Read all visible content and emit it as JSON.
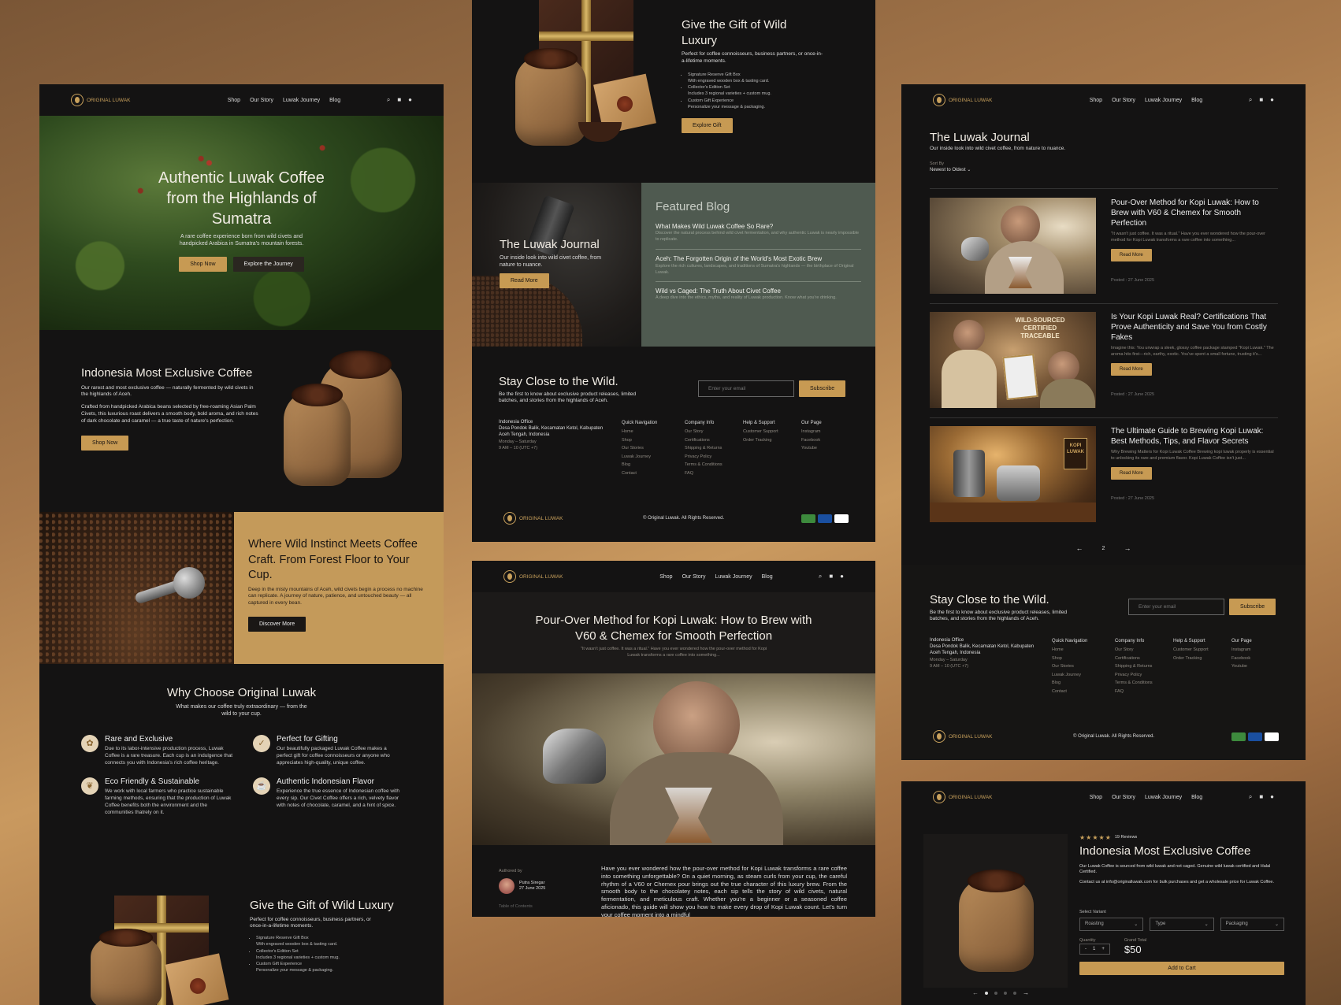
{
  "nav": {
    "logo": "ORIGINAL LUWAK",
    "links": [
      "Shop",
      "Our Story",
      "Luwak Journey",
      "Blog"
    ]
  },
  "home": {
    "hero_title": "Authentic Luwak Coffee from the Highlands of Sumatra",
    "hero_sub": "A rare coffee experience born from wild civets and handpicked Arabica in Sumatra's mountain forests.",
    "btn_shop": "Shop Now",
    "btn_explore": "Explore the Journey",
    "exclusive_title": "Indonesia Most Exclusive Coffee",
    "exclusive_p1": "Our rarest and most exclusive coffee — naturally fermented by wild civets in the highlands of Aceh.",
    "exclusive_p2": "Crafted from handpicked Arabica beans selected by free-roaming Asian Palm Civets, this luxurious roast delivers a smooth body, bold aroma, and rich notes of dark chocolate and caramel — a true taste of nature's perfection.",
    "exclusive_btn": "Shop Now",
    "instinct_title": "Where Wild Instinct Meets Coffee Craft. From Forest Floor to Your Cup.",
    "instinct_text": "Deep in the misty mountains of Aceh, wild civets begin a process no machine can replicate. A journey of nature, patience, and untouched beauty — all captured in every bean.",
    "instinct_btn": "Discover More",
    "why_title": "Why Choose Original Luwak",
    "why_sub": "What makes our coffee truly extraordinary — from the wild to your cup.",
    "features": [
      {
        "title": "Rare and Exclusive",
        "text": "Due to its labor-intensive production process, Luwak Coffee is a rare treasure. Each cup is an indulgence that connects you with Indonesia's rich coffee heritage."
      },
      {
        "title": "Perfect for Gifting",
        "text": "Our beautifully packaged Luwak Coffee makes a perfect gift for coffee connoisseurs or anyone who appreciates high-quality, unique coffee."
      },
      {
        "title": "Eco Friendly & Sustainable",
        "text": "We work with local farmers who practice sustainable farming methods, ensuring that the production of Luwak Coffee benefits both the environment and the communities thatrely on it."
      },
      {
        "title": "Authentic Indonesian Flavor",
        "text": "Experience the true essence of Indonesian coffee with every sip. Our Civet Coffee offers a rich, velvety flavor with notes of chocolate, caramel, and a hint of spice."
      }
    ]
  },
  "gift": {
    "title": "Give the Gift of Wild Luxury",
    "sub": "Perfect for coffee connoisseurs, business partners, or once-in-a-lifetime moments.",
    "items": [
      {
        "name": "Signature Reserve Gift Box",
        "desc": "With engraved wooden box & tasting card."
      },
      {
        "name": "Collector's Edition Set",
        "desc": "Includes 3 regional varieties + custom mug."
      },
      {
        "name": "Custom Gift Experience",
        "desc": "Personalize your message & packaging."
      }
    ],
    "btn": "Explore Gift"
  },
  "journal_banner": {
    "title": "The Luwak Journal",
    "sub": "Our inside look into wild civet coffee, from nature to nuance.",
    "btn": "Read More"
  },
  "featured": {
    "title": "Featured Blog",
    "items": [
      {
        "title": "What Makes Wild Luwak Coffee So Rare?",
        "text": "Discover the natural process behind wild civet fermentation, and why authentic Luwak is nearly impossible to replicate."
      },
      {
        "title": "Aceh: The Forgotten Origin of the World's Most Exotic Brew",
        "text": "Explore the rich cultures, landscapes, and traditions of Sumatra's highlands — the birthplace of Original Luwak."
      },
      {
        "title": "Wild vs Caged: The Truth About Civet Coffee",
        "text": "A deep dive into the ethics, myths, and reality of Luwak production. Know what you're drinking."
      }
    ]
  },
  "newsletter": {
    "title": "Stay Close to the Wild.",
    "sub": "Be the first to know about exclusive product releases, limited batches, and stories from the highlands of Aceh.",
    "placeholder": "Enter your email",
    "btn": "Subscribe"
  },
  "footer": {
    "office_title": "Indonesia Office",
    "office_addr": "Desa Pondok Balik, Kecamatan Ketol, Kabupaten Aceh Tengah, Indonesia",
    "hours": "Monday – Saturday",
    "hours2": "9 AM – 10 (UTC +7)",
    "cols": [
      {
        "h": "Quick Navigation",
        "items": [
          "Home",
          "Shop",
          "Our Stories",
          "Luwak Journey",
          "Blog",
          "Contact"
        ]
      },
      {
        "h": "Company Info",
        "items": [
          "Our Story",
          "Certifications",
          "Shipping & Returns",
          "Privacy Policy",
          "Terms & Conditions",
          "FAQ"
        ]
      },
      {
        "h": "Help & Support",
        "items": [
          "Customer Support",
          "Order Tracking"
        ]
      },
      {
        "h": "Our Page",
        "items": [
          "Instagram",
          "Facebook",
          "Youtube"
        ]
      }
    ],
    "copyright": "© Original Luwak. All Rights Reserved."
  },
  "article": {
    "title": "Pour-Over Method for Kopi Luwak: How to Brew with V60 & Chemex for Smooth Perfection",
    "excerpt": "\"It wasn't just coffee. It was a ritual.\" Have you ever wondered how the pour-over method for Kopi Luwak transforms a rare coffee into something...",
    "authored_by": "Authored by",
    "author": "Putra Siregar",
    "date": "27 June 2025",
    "toc": "Table of Contents",
    "body": "Have you ever wondered how the pour-over method for Kopi Luwak transforms a rare coffee into something unforgettable? On a quiet morning, as steam curls from your cup, the careful rhythm of a V60 or Chemex pour brings out the true character of this luxury brew. From the smooth body to the chocolatey notes, each sip tells the story of wild civets, natural fermentation, and meticulous craft. Whether you're a beginner or a seasoned coffee aficionado, this guide will show you how to make every drop of Kopi Luwak count. Let's turn your coffee moment into a mindful"
  },
  "journal": {
    "title": "The Luwak Journal",
    "sub": "Our inside look into wild civet coffee, from nature to nuance.",
    "sort_label": "Sort By",
    "sort_value": "Newest to Oldest",
    "posts": [
      {
        "title": "Pour-Over Method for Kopi Luwak: How to Brew with V60 & Chemex for Smooth Perfection",
        "text": "\"It wasn't just coffee. It was a ritual.\" Have you ever wondered how the pour-over method for Kopi Luwak transforms a rare coffee into something...",
        "posted": "Posted : 27 June 2025"
      },
      {
        "title": "Is Your Kopi Luwak Real? Certifications That Prove Authenticity and Save You from Costly Fakes",
        "text": "Imagine this: You unwrap a sleek, glossy coffee package stamped \"Kopi Luwak.\" The aroma hits first—rich, earthy, exotic. You've spent a small fortune, trusting it's...",
        "posted": "Posted : 27 June 2025"
      },
      {
        "title": "The Ultimate Guide to Brewing Kopi Luwak: Best Methods, Tips, and Flavor Secrets",
        "text": "Why Brewing Matters for Kopi Luwak Coffee Brewing kopi luwak properly is essential to unlocking its rare and premium flavor. Kopi Luwak Coffee isn't just...",
        "posted": "Posted : 27 June 2025"
      }
    ],
    "read_more": "Read More",
    "page": "2",
    "img2_text": "WILD-SOURCED CERTIFIED TRACEABLE",
    "img3_text": "KOPI LUWAK"
  },
  "product": {
    "reviews": "19 Reviews",
    "rating": 5,
    "title": "Indonesia Most Exclusive Coffee",
    "desc": "Our Luwak Coffee is sourced from wild luwak and not caged. Genuine wild luwak certified and Halal Certified.",
    "contact": "Contact us at info@originalluwak.com for bulk purchases and get a wholesale price for Luwak Coffee.",
    "variant_label": "Select Variant",
    "variants": [
      "Roasting",
      "Type",
      "Packaging"
    ],
    "qty_label": "Quantity",
    "qty": "1",
    "total_label": "Grand Total",
    "total": "$50",
    "cart_btn": "Add to Cart"
  },
  "colors": {
    "accent": "#c79a53",
    "bg": "#141313",
    "sage": "#4f5a50"
  }
}
